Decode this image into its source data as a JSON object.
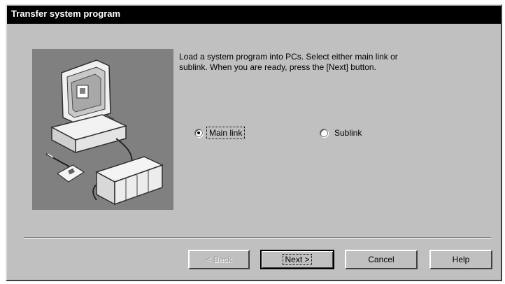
{
  "window": {
    "title": "Transfer system program"
  },
  "instruction": "Load a system program into PCs. Select either main link or\nsublink. When you are ready, press the [Next] button.",
  "link_options": [
    {
      "label": "Main link",
      "selected": true
    },
    {
      "label": "Sublink",
      "selected": false
    }
  ],
  "buttons": {
    "back": "< Back",
    "next": "Next >",
    "cancel": "Cancel",
    "help": "Help"
  },
  "picture": {
    "icon": "computer-plc-illustration"
  },
  "colors": {
    "dialog_bg": "#c0c0c0",
    "title_bar": "#000000",
    "picture_bg": "#808080"
  }
}
